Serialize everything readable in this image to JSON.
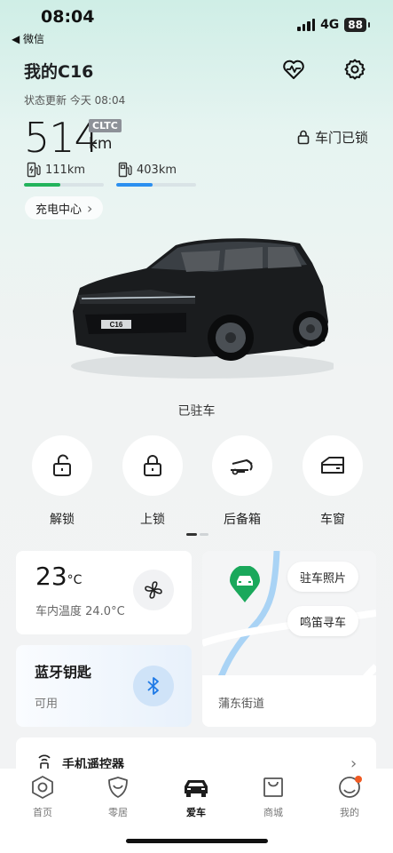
{
  "status_bar": {
    "time": "08:04",
    "back_app": "◀ 微信",
    "network": "4G",
    "battery": "88"
  },
  "header": {
    "vehicle_name": "我的C16",
    "icons": [
      "heart-pulse-icon",
      "gear-icon"
    ]
  },
  "status": {
    "updated_text": "状态更新 今天 08:04"
  },
  "range": {
    "value": "514",
    "unit": "km",
    "standard": "CLTC",
    "door_status": "车门已锁"
  },
  "energy": {
    "electric": {
      "label": "111km",
      "level": 0.45,
      "color": "#22b35c"
    },
    "fuel": {
      "label": "403km",
      "level": 0.45,
      "color": "#2b8ff0"
    }
  },
  "charge_center": {
    "label": "充电中心",
    "chevron": "›"
  },
  "car": {
    "plate": "C16",
    "state": "已驻车"
  },
  "controls": [
    {
      "label": "解锁",
      "icon": "unlock-icon"
    },
    {
      "label": "上锁",
      "icon": "lock-icon"
    },
    {
      "label": "后备箱",
      "icon": "trunk-icon"
    },
    {
      "label": "车窗",
      "icon": "window-icon"
    }
  ],
  "climate": {
    "temp_value": "23",
    "temp_unit": "°C",
    "inside_label": "车内温度 24.0°C"
  },
  "bluetooth": {
    "title": "蓝牙钥匙",
    "status": "可用"
  },
  "map_card": {
    "parking_photo": "驻车照片",
    "honk_find": "鸣笛寻车",
    "address": "蒲东街道"
  },
  "remote": {
    "label": "手机遥控器",
    "chevron": "›"
  },
  "tabs": [
    {
      "label": "首页",
      "icon": "home-hex-icon"
    },
    {
      "label": "零居",
      "icon": "shield-smile-icon"
    },
    {
      "label": "爱车",
      "icon": "car-icon",
      "active": true
    },
    {
      "label": "商城",
      "icon": "shopping-bag-icon"
    },
    {
      "label": "我的",
      "icon": "profile-icon"
    }
  ],
  "colors": {
    "accent_green": "#22b35c",
    "accent_blue": "#2b8ff0",
    "notification": "#f05a22"
  }
}
